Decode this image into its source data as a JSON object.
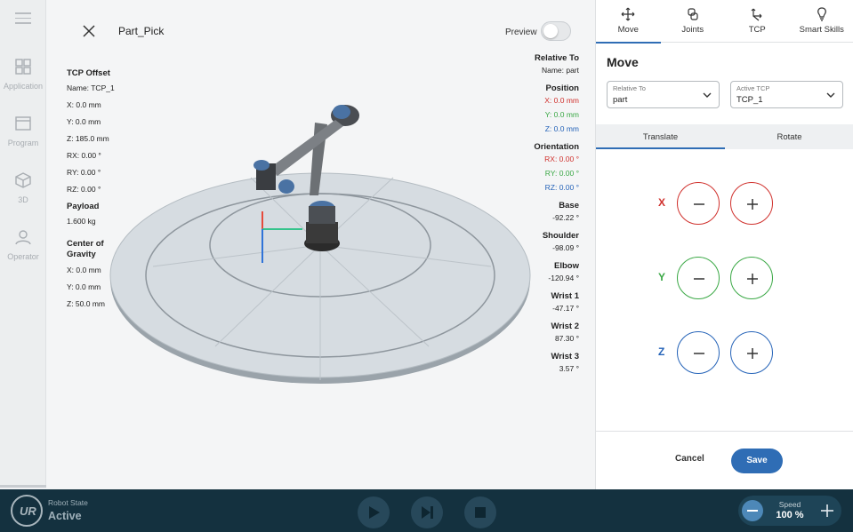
{
  "rail": {
    "items": [
      {
        "label": "Application",
        "icon": "grid-icon"
      },
      {
        "label": "Program",
        "icon": "program-icon"
      },
      {
        "label": "3D",
        "icon": "cube-icon"
      },
      {
        "label": "Operator",
        "icon": "person-icon"
      }
    ]
  },
  "header": {
    "program_name": "Part_Pick",
    "preview_label": "Preview",
    "preview_enabled": false
  },
  "tcp_info": {
    "title": "TCP Offset",
    "name": "Name: TCP_1",
    "x": "X: 0.0 mm",
    "y": "Y: 0.0 mm",
    "z": "Z: 185.0 mm",
    "rx": "RX: 0.00 °",
    "ry": "RY: 0.00 °",
    "rz": "RZ: 0.00 °",
    "payload_title": "Payload",
    "payload_value": "1.600 kg",
    "cog_title": "Center of Gravity",
    "cog_x": "X: 0.0 mm",
    "cog_y": "Y: 0.0 mm",
    "cog_z": "Z: 50.0 mm"
  },
  "pose_info": {
    "relative_title": "Relative To",
    "relative_name": "Name: part",
    "position_title": "Position",
    "pos_x": "X: 0.0 mm",
    "pos_y": "Y: 0.0 mm",
    "pos_z": "Z: 0.0 mm",
    "orientation_title": "Orientation",
    "rx": "RX: 0.00 °",
    "ry": "RY: 0.00 °",
    "rz": "RZ: 0.00 °",
    "joints": [
      {
        "name": "Base",
        "value": "-92.22 °"
      },
      {
        "name": "Shoulder",
        "value": "-98.09 °"
      },
      {
        "name": "Elbow",
        "value": "-120.94 °"
      },
      {
        "name": "Wrist 1",
        "value": "-47.17 °"
      },
      {
        "name": "Wrist 2",
        "value": "87.30 °"
      },
      {
        "name": "Wrist 3",
        "value": "3.57 °"
      }
    ]
  },
  "panel": {
    "tabs": [
      {
        "label": "Move",
        "icon": "move-icon",
        "active": true
      },
      {
        "label": "Joints",
        "icon": "joints-icon",
        "active": false
      },
      {
        "label": "TCP",
        "icon": "tcp-icon",
        "active": false
      },
      {
        "label": "Smart Skills",
        "icon": "lightbulb-icon",
        "active": false
      }
    ],
    "title": "Move",
    "relative_to": {
      "label": "Relative To",
      "value": "part"
    },
    "active_tcp": {
      "label": "Active TCP",
      "value": "TCP_1"
    },
    "subtabs": [
      {
        "label": "Translate",
        "active": true
      },
      {
        "label": "Rotate",
        "active": false
      }
    ],
    "axes": [
      {
        "label": "X",
        "color": "#d0312d"
      },
      {
        "label": "Y",
        "color": "#3aa845"
      },
      {
        "label": "Z",
        "color": "#2563b8"
      }
    ],
    "cancel_label": "Cancel",
    "save_label": "Save"
  },
  "bottom": {
    "logo_text": "UR",
    "state_label": "Robot State",
    "state_value": "Active",
    "speed_label": "Speed",
    "speed_value": "100 %"
  },
  "colors": {
    "accent": "#2f6db5",
    "bottom_bar": "#14313f"
  }
}
